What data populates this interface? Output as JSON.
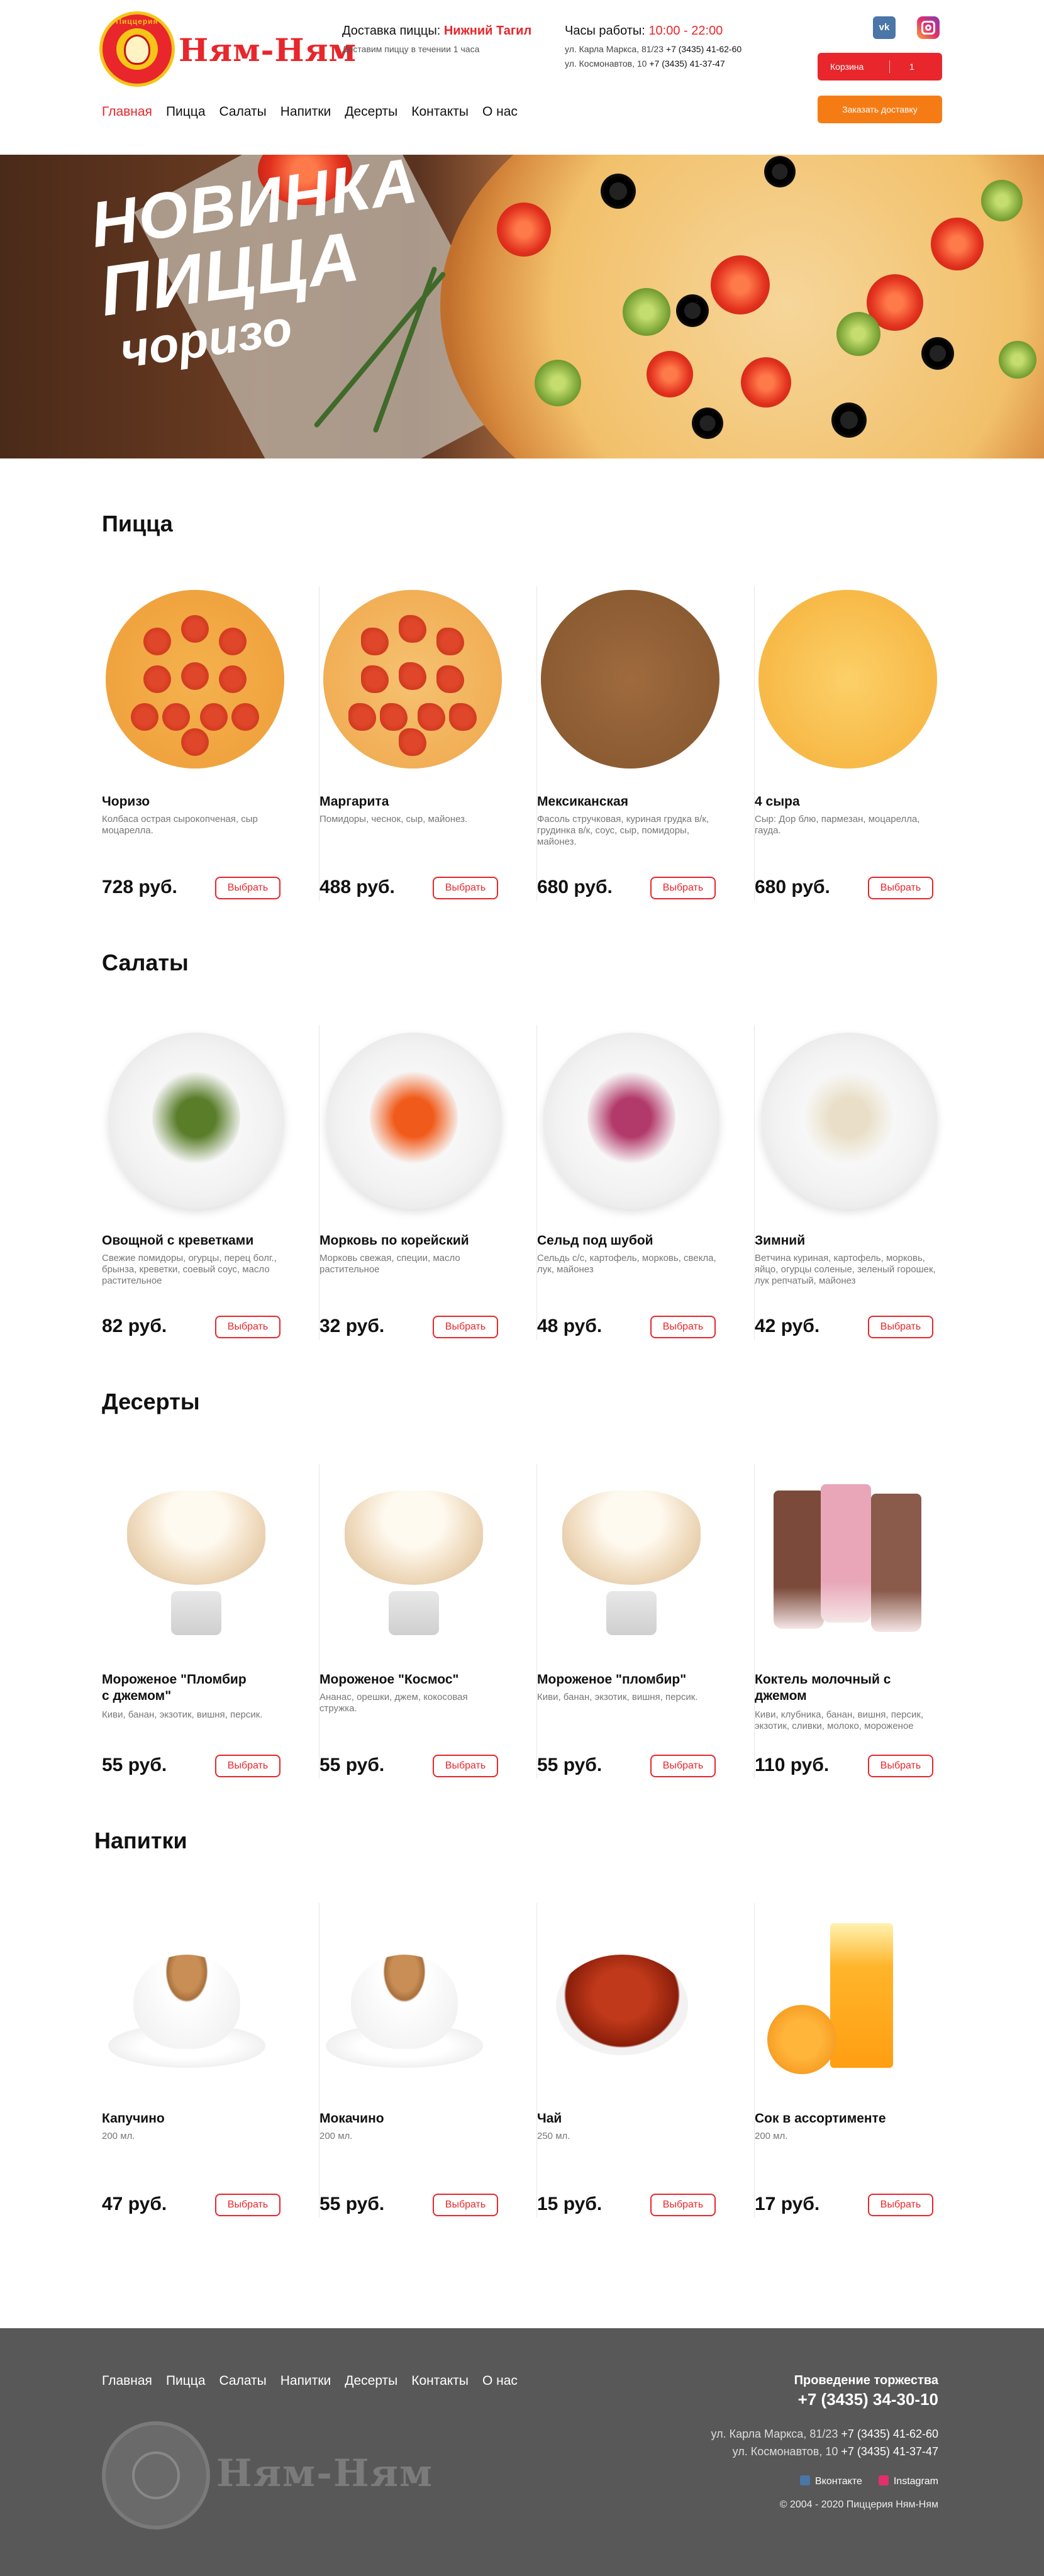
{
  "header": {
    "brand": "Ням-Ням",
    "logo_ring_text": "Пиццерия",
    "delivery_label": "Доставка пиццы:",
    "delivery_city": "Нижний Тагил",
    "delivery_note": "Доставим пиццу в течении 1 часа",
    "hours_label": "Часы работы:",
    "hours_value": "10:00 - 22:00",
    "address1": "ул. Карла Маркса, 81/23",
    "phone1": "+7 (3435) 41-62-60",
    "address2": "ул. Космонавтов, 10",
    "phone2": "+7 (3435)  41-37-47",
    "vk_icon_text": "vk",
    "cart_label": "Корзина",
    "cart_count": "1",
    "order_button": "Заказать доставку",
    "accent": "#e8262b",
    "orange": "#f57c14"
  },
  "nav": [
    "Главная",
    "Пицца",
    "Салаты",
    "Напитки",
    "Десерты",
    "Контакты",
    "О нас"
  ],
  "hero": {
    "line1": "НОВИНКА",
    "line2": "ПИЦЦА",
    "line3": "чоризо"
  },
  "select_label": "Выбрать",
  "sections": [
    {
      "title": "Пицца",
      "items": [
        {
          "name": "Чоризо",
          "desc": "Колбаса острая сырокопченая, сыр моцарелла.",
          "price": "728 руб."
        },
        {
          "name": "Маргарита",
          "desc": "Помидоры, чеснок, сыр, майонез.",
          "price": "488 руб."
        },
        {
          "name": "Мексиканская",
          "desc": "Фасоль стручковая, куриная грудка в/к, грудинка в/к, соус, сыр, помидоры, майонез.",
          "price": "680 руб."
        },
        {
          "name": "4 сыра",
          "desc": "Сыр: Дор блю, пармезан, моцарелла, гауда.",
          "price": "680 руб."
        }
      ]
    },
    {
      "title": "Салаты",
      "items": [
        {
          "name": "Овощной с креветками",
          "desc": "Свежие помидоры, огурцы, перец болг., брынза, креветки, соевый соус, масло растительное",
          "price": "82 руб."
        },
        {
          "name": "Морковь по корейский",
          "desc": "Морковь свежая, специи, масло растительное",
          "price": "32 руб."
        },
        {
          "name": "Сельд под шубой",
          "desc": "Сельдь с/с, картофель, морковь, свекла, лук, майонез",
          "price": "48 руб."
        },
        {
          "name": "Зимний",
          "desc": "Ветчина куриная, картофель, морковь, яйцо, огурцы соленые, зеленый горошек, лук репчатый, майонез",
          "price": "42 руб."
        }
      ]
    },
    {
      "title": "Десерты",
      "items": [
        {
          "name": "Мороженое \"Пломбир с джемом\"",
          "desc": "Киви, банан, экзотик, вишня, персик.",
          "price": "55 руб."
        },
        {
          "name": "Мороженое \"Космос\"",
          "desc": "Ананас, орешки, джем, кокосовая стружка.",
          "price": "55 руб."
        },
        {
          "name": "Мороженое \"пломбир\"",
          "desc": "Киви, банан, экзотик, вишня, персик.",
          "price": "55 руб."
        },
        {
          "name": "Коктель молочный с джемом",
          "desc": "Киви, клубника, банан, вишня, персик, экзотик, сливки, молоко, мороженое",
          "price": "110 руб."
        }
      ]
    },
    {
      "title": "Напитки",
      "items": [
        {
          "name": "Капучино",
          "desc": "200 мл.",
          "price": "47 руб."
        },
        {
          "name": "Мокачино",
          "desc": "200 мл.",
          "price": "55 руб."
        },
        {
          "name": "Чай",
          "desc": "250 мл.",
          "price": "15 руб."
        },
        {
          "name": "Сок в ассортименте",
          "desc": "200 мл.",
          "price": "17 руб."
        }
      ]
    }
  ],
  "footer": {
    "event_label": "Проведение торжества",
    "event_phone": "+7 (3435) 34-30-10",
    "address1": "ул. Карла Маркса, 81/23",
    "phone1": "+7 (3435) 41-62-60",
    "address2": "ул. Космонавтов, 10",
    "phone2": "+7 (3435) 41-37-47",
    "vk": "Вконтакте",
    "instagram": "Instagram",
    "copyright": "© 2004 - 2020 Пиццерия Ням-Ням",
    "brand": "Ням-Ням",
    "logo_ring_text": "Пиццерия",
    "background": "#585858"
  }
}
